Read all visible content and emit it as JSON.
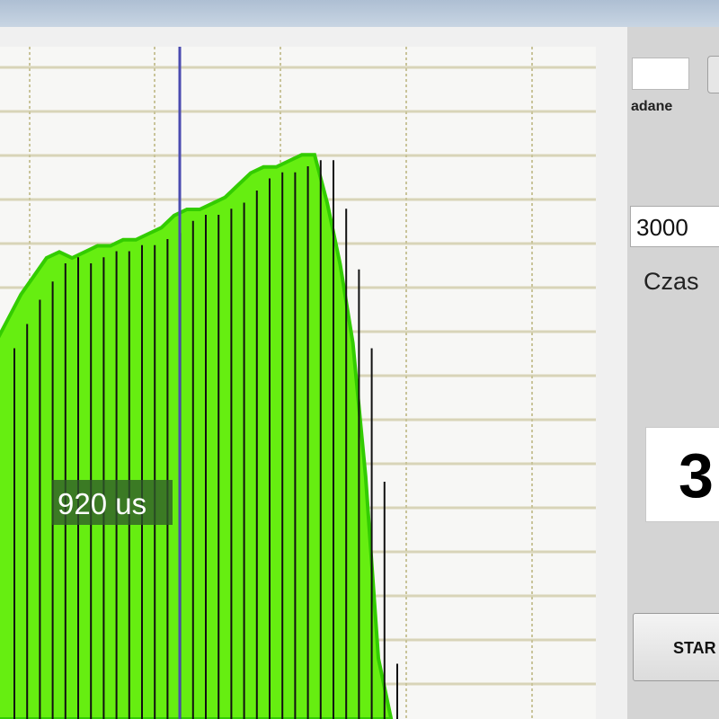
{
  "panel": {
    "zadane_label": "adane",
    "input_value": "3000",
    "czas_label": "Czas",
    "big_number": "3",
    "start_label": "STAR"
  },
  "cursor_label": "920 us",
  "chart_data": {
    "type": "bar",
    "area_fill": "#66ee11",
    "bar_line_color": "#111111",
    "cursor_color": "#4b4bb0",
    "values": [
      0.62,
      0.66,
      0.7,
      0.73,
      0.76,
      0.77,
      0.76,
      0.77,
      0.78,
      0.78,
      0.79,
      0.79,
      0.8,
      0.81,
      0.83,
      0.84,
      0.84,
      0.85,
      0.86,
      0.88,
      0.9,
      0.91,
      0.91,
      0.92,
      0.93,
      0.93,
      0.85,
      0.75,
      0.62,
      0.4,
      0.1,
      0.0
    ]
  }
}
